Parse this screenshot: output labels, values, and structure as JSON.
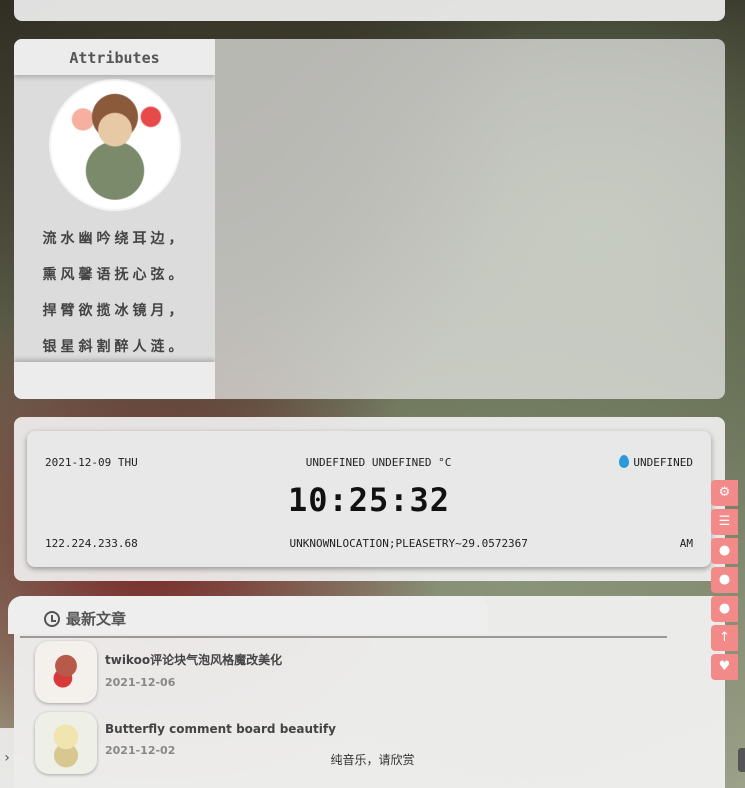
{
  "attributes": {
    "title": "Attributes",
    "poem": [
      "流水幽吟绕耳边，",
      "熏风馨语抚心弦。",
      "捍臂欲揽冰镜月，",
      "银星斜割醉人涟。"
    ]
  },
  "clock": {
    "date": "2021-12-09 THU",
    "weather": "UNDEFINED UNDEFINED °C",
    "humidity": "UNDEFINED",
    "time": "10:25:32",
    "ip": "122.224.233.68",
    "location": "UNKNOWNLOCATION;PLEASETRY~29.0572367",
    "ampm": "AM"
  },
  "recent_posts": {
    "header": "最新文章",
    "items": [
      {
        "title": "twikoo评论块气泡风格魔改美化",
        "date": "2021-12-06"
      },
      {
        "title": "Butterfly comment board beautify",
        "date": "2021-12-02"
      }
    ]
  },
  "side_buttons": [
    "gear-icon",
    "list-icon",
    "fire-icon",
    "comment-icon",
    "chat-icon",
    "arrow-up-icon",
    "heart-icon"
  ],
  "music": {
    "text": "纯音乐，请欣赏"
  }
}
